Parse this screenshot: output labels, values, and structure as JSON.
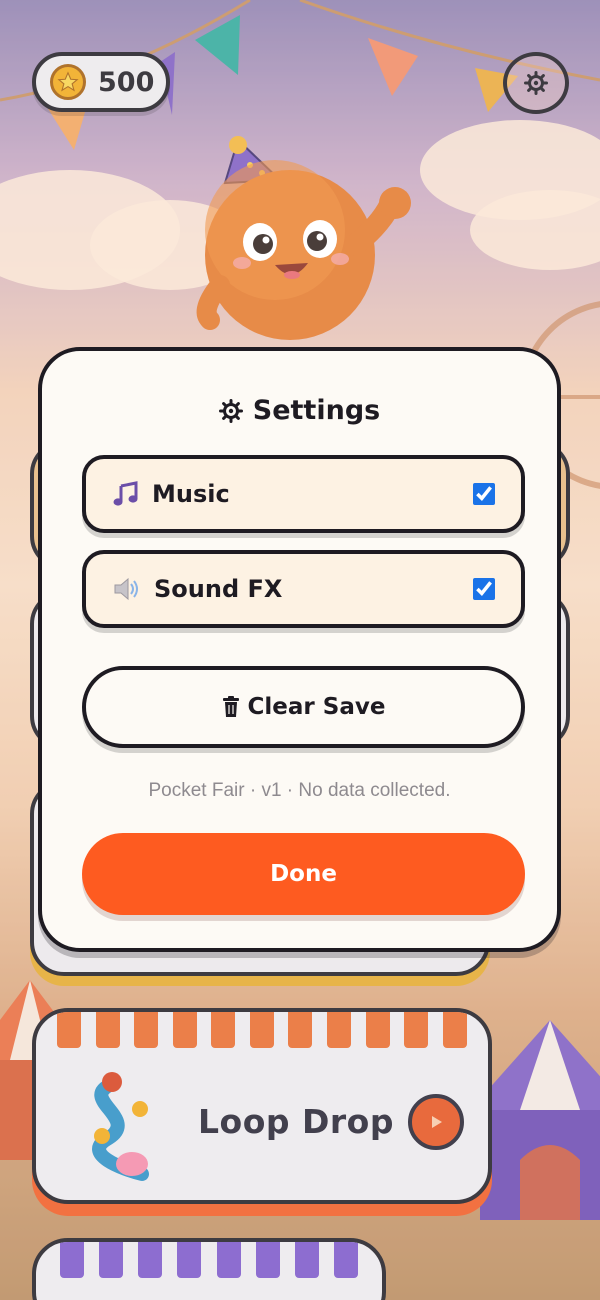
{
  "hud": {
    "coins": "500"
  },
  "modal": {
    "title": "Settings",
    "music": {
      "label": "Music",
      "checked": true
    },
    "sound_fx": {
      "label": "Sound FX",
      "checked": true
    },
    "clear_save_label": "Clear Save",
    "footer_note": "Pocket Fair · v1 · No data collected.",
    "done_label": "Done"
  },
  "game_cards": [
    {
      "title": "Loop Drop"
    }
  ],
  "colors": {
    "accent": "#fe5b20",
    "outline": "#1e1b22",
    "modal_bg": "#fdfaf5",
    "row_bg": "#fdf2e3",
    "checkbox": "#1a73e8",
    "music_icon": "#6b4ea8"
  },
  "icons": [
    "star-coin-icon",
    "gear-icon",
    "music-note-icon",
    "speaker-icon",
    "trash-icon",
    "play-icon"
  ]
}
